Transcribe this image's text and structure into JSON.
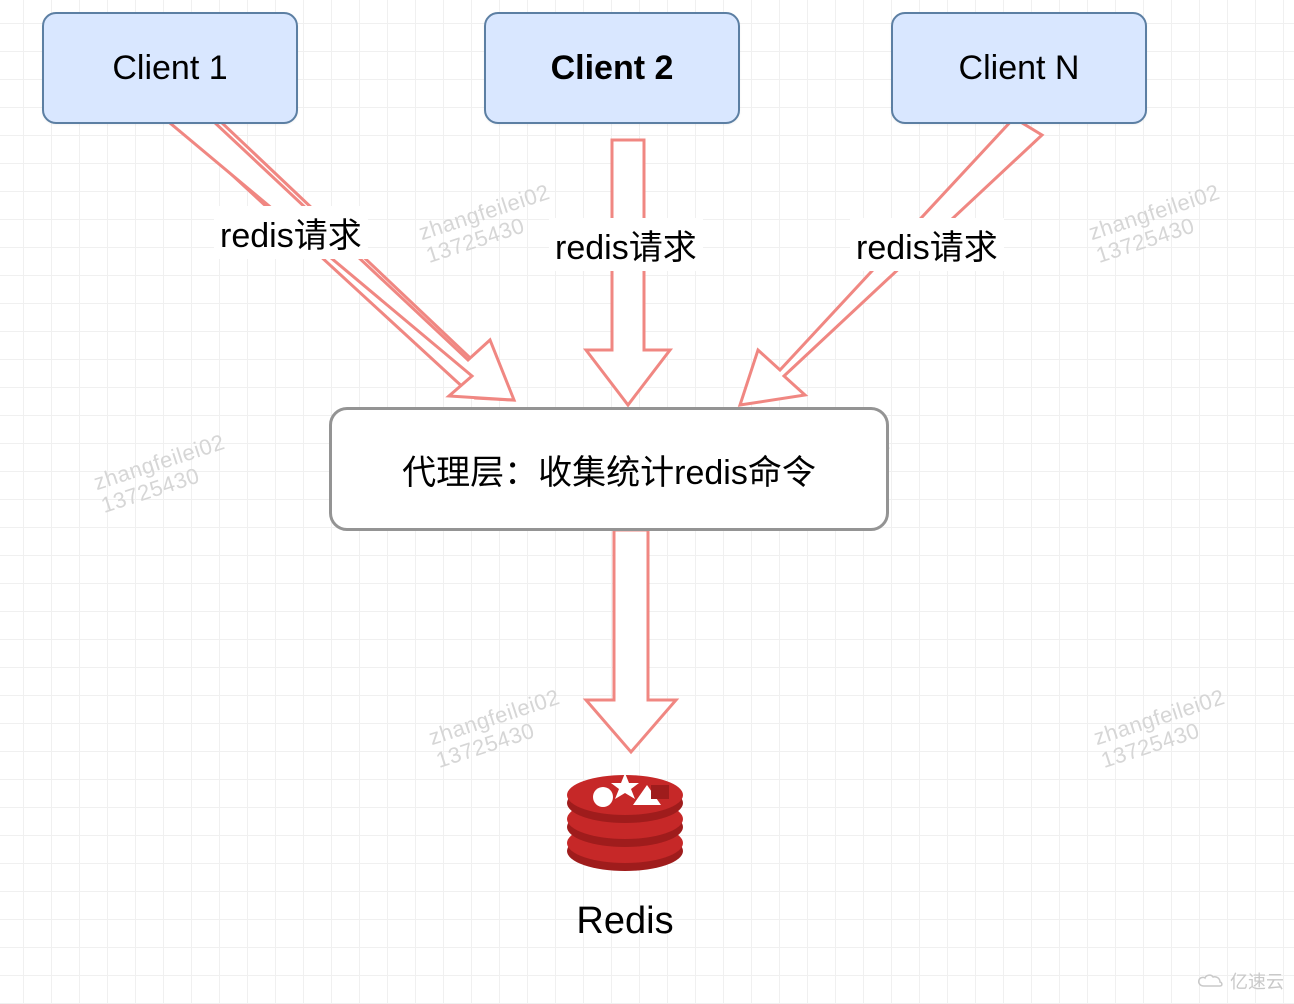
{
  "nodes": {
    "client1": {
      "label": "Client 1"
    },
    "client2": {
      "label": "Client 2"
    },
    "clientN": {
      "label": "Client N"
    },
    "proxy": {
      "label": "代理层：收集统计redis命令"
    },
    "redis": {
      "label": "Redis"
    }
  },
  "edges": {
    "c1_proxy": {
      "label": "redis请求"
    },
    "c2_proxy": {
      "label": "redis请求"
    },
    "cN_proxy": {
      "label": "redis请求"
    }
  },
  "colors": {
    "client_fill": "#d9e7ff",
    "client_border": "#5c7fa3",
    "proxy_border": "#949494",
    "arrow": "#f08782",
    "redis_red": "#c62828",
    "redis_red_dark": "#9f1c1c"
  },
  "watermark": {
    "line1": "zhangfeilei02",
    "line2": "13725430"
  },
  "site": "亿速云"
}
